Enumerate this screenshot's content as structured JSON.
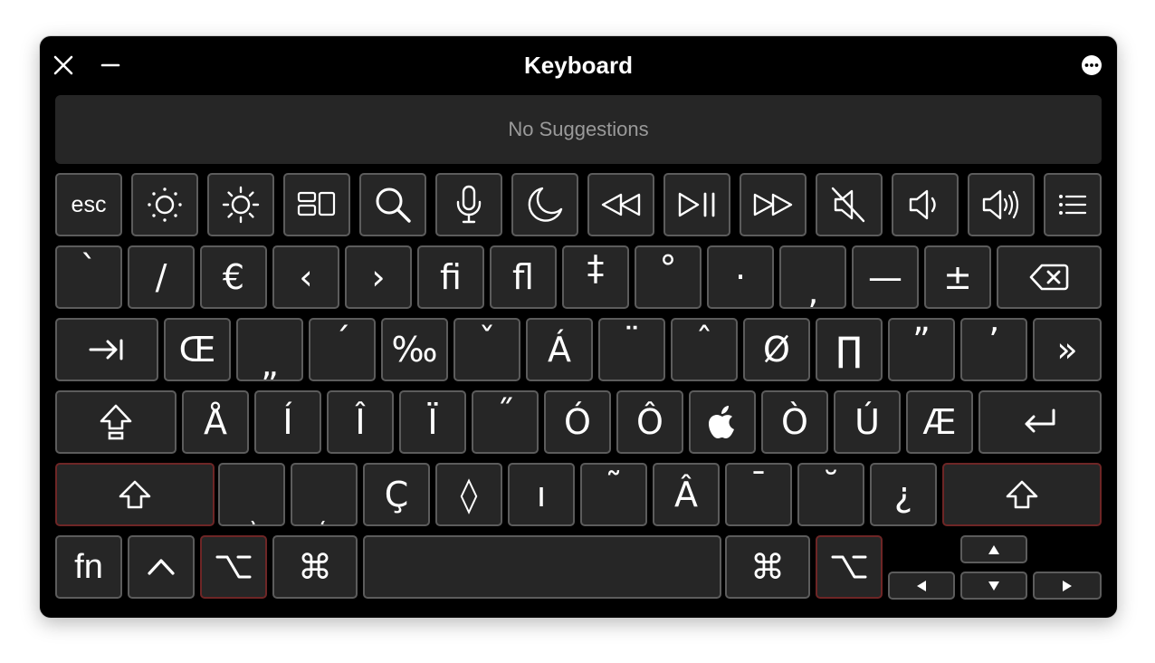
{
  "window": {
    "title": "Keyboard"
  },
  "suggestions": {
    "text": "No Suggestions"
  },
  "rows": {
    "function": [
      "esc"
    ],
    "row1": [
      "`",
      "/",
      "€",
      "‹",
      "›",
      "ﬁ",
      "ﬂ",
      "‡",
      "°",
      "·",
      "‚",
      "—",
      "±"
    ],
    "row2": [
      "Œ",
      "„",
      "´",
      "‰",
      "ˇ",
      "Á",
      "¨",
      "ˆ",
      "Ø",
      "∏",
      "”",
      "’",
      "»"
    ],
    "row3": [
      "Å",
      "Í",
      "Î",
      "Ï",
      "˝",
      "Ó",
      "Ô",
      "Ò",
      "Ú",
      "Æ"
    ],
    "row4": [
      "¸",
      "˛",
      "Ç",
      "◊",
      "ı",
      "˜",
      "Â",
      "¯",
      "˘",
      "¿"
    ],
    "row5": [
      "fn",
      "⌘",
      "⌘"
    ]
  },
  "icons": {
    "titlebar": [
      "close-icon",
      "minimize-icon",
      "more-icon"
    ],
    "function": [
      "brightness-down-icon",
      "brightness-up-icon",
      "mission-control-icon",
      "search-icon",
      "microphone-icon",
      "do-not-disturb-icon",
      "rewind-icon",
      "play-pause-icon",
      "fast-forward-icon",
      "mute-icon",
      "volume-down-icon",
      "volume-up-icon",
      "list-icon"
    ]
  },
  "colors": {
    "window_bg": "#000000",
    "key_bg": "#262626",
    "key_border": "#5c5c5c",
    "active_modifier_border": "#6e2626"
  }
}
